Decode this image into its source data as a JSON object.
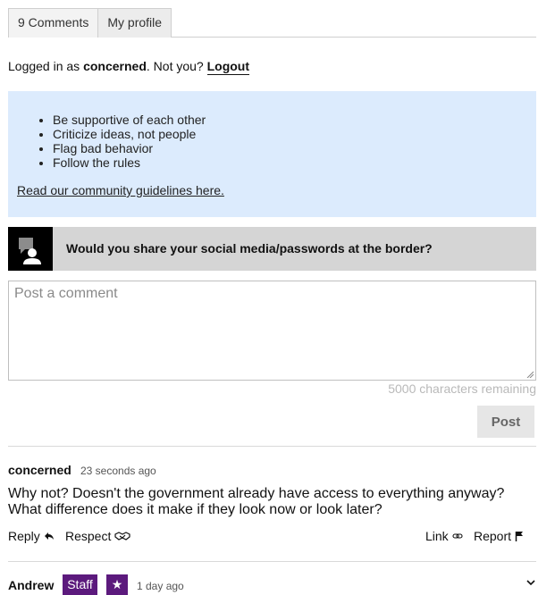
{
  "tabs": [
    {
      "label": "9 Comments"
    },
    {
      "label": "My profile"
    }
  ],
  "login": {
    "prefix": "Logged in as ",
    "username": "concerned",
    "middle": ". Not you? ",
    "logout_label": "Logout"
  },
  "guidelines": {
    "items": [
      "Be supportive of each other",
      "Criticize ideas, not people",
      "Flag bad behavior",
      "Follow the rules"
    ],
    "link_label": "Read our community guidelines here.",
    "bg_color": "#dcebfd"
  },
  "question": {
    "text": "Would you share your social media/passwords at the border?"
  },
  "composer": {
    "placeholder": "Post a comment",
    "value": "",
    "remaining": "5000 characters remaining",
    "post_label": "Post"
  },
  "comments": [
    {
      "author": "concerned",
      "time": "23 seconds ago",
      "body": "Why not? Doesn't the government already have access to everything anyway? What difference does it make if they look now or look later?",
      "actions": {
        "reply": "Reply",
        "respect": "Respect",
        "link": "Link",
        "report": "Report"
      }
    },
    {
      "author": "Andrew",
      "badge_staff": "Staff",
      "badge_star": "★",
      "time": "1 day ago"
    }
  ],
  "colors": {
    "staff_badge": "#5c1a7d",
    "question_bg": "#d5d5d5"
  },
  "icons": [
    "chat-user-icon",
    "reply-icon",
    "respect-icon",
    "link-icon",
    "flag-icon",
    "chevron-down-icon",
    "star-icon"
  ]
}
